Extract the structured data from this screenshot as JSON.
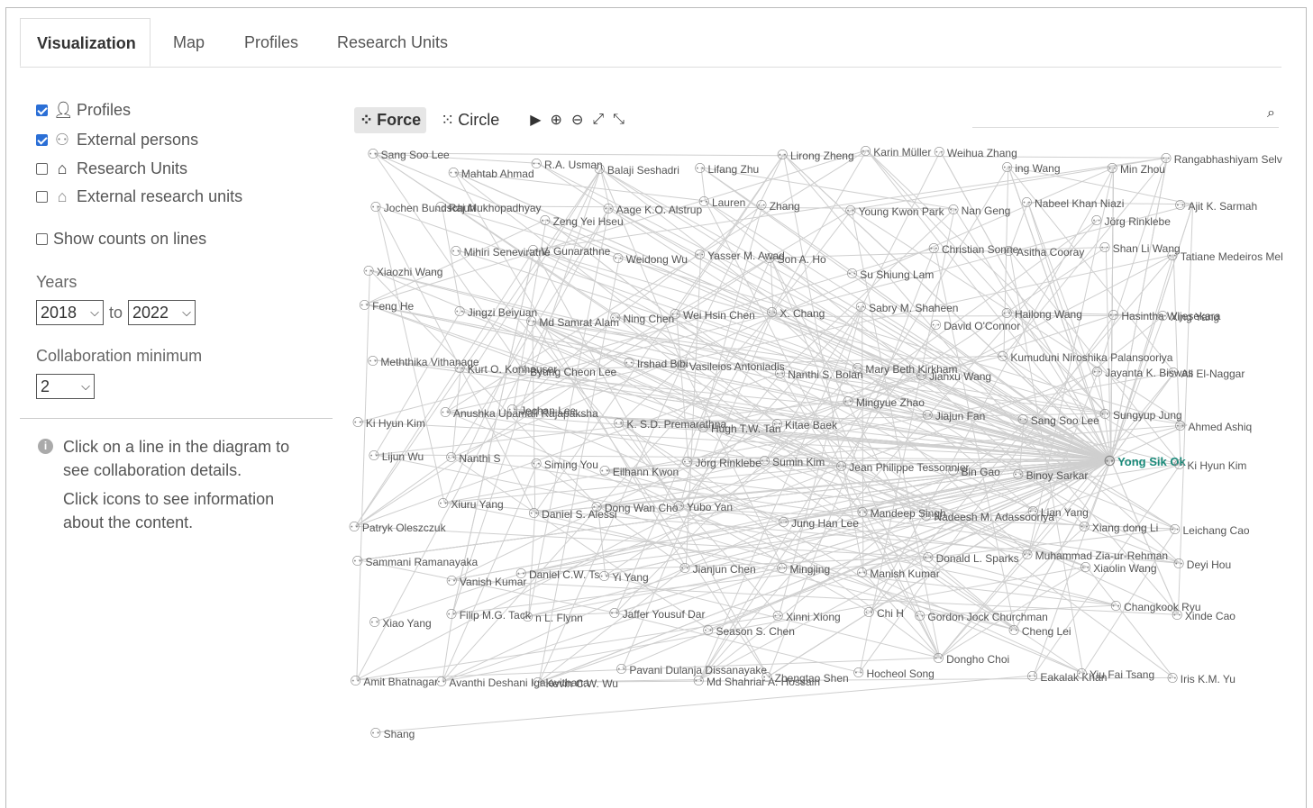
{
  "tabs": [
    "Visualization",
    "Map",
    "Profiles",
    "Research Units"
  ],
  "filters": [
    {
      "label": "Profiles",
      "checked": true,
      "icon": "person-filled-icon"
    },
    {
      "label": "External persons",
      "checked": true,
      "icon": "person-outline-icon"
    },
    {
      "label": "Research Units",
      "checked": false,
      "icon": "house-filled-icon"
    },
    {
      "label": "External research units",
      "checked": false,
      "icon": "house-outline-icon"
    }
  ],
  "show_counts_label": "Show counts on lines",
  "years_label": "Years",
  "year_from": "2018",
  "year_to_label": "to",
  "year_to": "2022",
  "collab_label": "Collaboration minimum",
  "collab_value": "2",
  "info_text_1": "Click on a line in the diagram to see collaboration details.",
  "info_text_2": "Click icons to see information about the content.",
  "toolbar": {
    "force": "Force",
    "circle": "Circle"
  },
  "graph_labels": [
    "Sang Soo Lee",
    "Mahtab Ahmad",
    "R.A. Usman",
    "Balaji Seshadri",
    "Lifang Zhu",
    "Lirong Zheng",
    "Karin Müller",
    "Weihua Zhang",
    "ing Wang",
    "Min Zhou",
    "Rangabhashiyam Selvasembian",
    "Jochen Bundschuh",
    "Raj Mukhopadhyay",
    "Zeng Yei Hseu",
    "Aage K.O. Alstrup",
    "Lauren",
    "Zhang",
    "Young Kwon Park",
    "Nan Geng",
    "Nabeel Khan Niazi",
    "Jörg Rinklebe",
    "Ajit K. Sarmah",
    "Xiaozhi Wang",
    "Mihiri Seneviratne",
    "V. Gunarathne",
    "Weidong Wu",
    "Yasser M. Awad",
    "Son A. Ho",
    "Su Shiung Lam",
    "Christian Sonne",
    "Asitha Cooray",
    "Shan Li Wang",
    "Tatiane Medeiros Melo",
    "Feng He",
    "Jingzi Beiyuan",
    "Md Samrat Alam",
    "Ning Chen",
    "Wei Hsin Chen",
    "X. Chang",
    "Sabry M. Shaheen",
    "David O'Connor",
    "Hailong Wang",
    "Hasintha Wijesekara",
    "Xing Yang",
    "Meththika Vithanage",
    "Kurt O. Konhauser",
    "Byung Cheon Lee",
    "Irshad Bibi",
    "Vasileios Antoniadis",
    "Nanthi S. Bolan",
    "Mary Beth Kirkham",
    "Jianxu Wang",
    "Kumuduni Niroshika Palansooriya",
    "Jayanta K. Biswas",
    "Ali El-Naggar",
    "Ki Hyun Kim",
    "Anushka Upamali Rajapaksha",
    "Jechan Lee",
    "K. S.D. Premarathna",
    "Hugh T.W. Tan",
    "Kitae Baek",
    "Mingyue Zhao",
    "Jiajun Fan",
    "Sang Soo Lee",
    "Sungyup Jung",
    "Ahmed Ashiq",
    "Lijun Wu",
    "Nanthi S",
    "Siming You",
    "Eilhann Kwon",
    "Jörg Rinklebe",
    "Sumin Kim",
    "Jean Philippe Tessonnier",
    "Bin Gao",
    "Binoy Sarkar",
    "Yong Sik Ok",
    "Ki Hyun Kim",
    "Patryk Oleszczuk",
    "Xiuru Yang",
    "Daniel S. Alessi",
    "Dong Wan Cho",
    "Yubo Yan",
    "Jung Han Lee",
    "Mandeep Singh",
    "Nadeesh M. Adassooriya",
    "Lian Yang",
    "Xiang dong Li",
    "Leichang Cao",
    "Sammani Ramanayaka",
    "Vanish Kumar",
    "Daniel C.W. Ts",
    "Yi Yang",
    "Jianjun Chen",
    "Mingjing",
    "Manish Kumar",
    "Donald L. Sparks",
    "Muhammad Zia-ur-Rehman",
    "Xiaolin Wang",
    "Deyi Hou",
    "Xiao Yang",
    "Filip M.G. Tack",
    "n L. Flynn",
    "Jaffer Yousuf Dar",
    "Season S. Chen",
    "Xinni Xiong",
    "Chi H",
    "Gordon Jock Churchman",
    "Cheng Lei",
    "Changkook Ryu",
    "Xinde Cao",
    "Amit Bhatnagar",
    "Avanthi Deshani Igalavithana",
    "Kevin C.W. Wu",
    "Pavani Dulanja Dissanayake",
    "Md Shahriar A. Hossain",
    "Zhengtao Shen",
    "Hocheol Song",
    "Dongho Choi",
    "Eakalak Khan",
    "Yiu Fai Tsang",
    "Iris K.M. Yu",
    "Shang"
  ]
}
